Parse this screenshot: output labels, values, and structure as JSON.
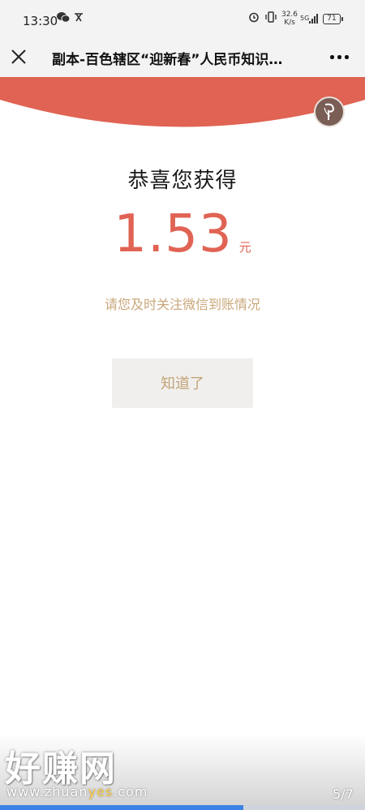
{
  "status_bar": {
    "time": "13:30",
    "speed_value": "32.6",
    "speed_unit": "K/s",
    "network": "5G",
    "battery": "71"
  },
  "nav": {
    "title": "副本-百色辖区“迎新春”人民币知识…"
  },
  "result": {
    "heading": "恭喜您获得",
    "amount": "1.53",
    "unit": "元",
    "notice": "请您及时关注微信到账情况",
    "confirm_label": "知道了"
  },
  "watermark": {
    "site_name": "好赚网",
    "url_prefix": "www.zhuan",
    "url_highlight": "yes",
    "url_suffix": ".com"
  },
  "pager": {
    "counter": "5/7",
    "current": 5,
    "total": 7
  },
  "colors": {
    "accent_red": "#e06353",
    "gold_text": "#c4a47a",
    "progress_blue": "#3b82e6"
  }
}
